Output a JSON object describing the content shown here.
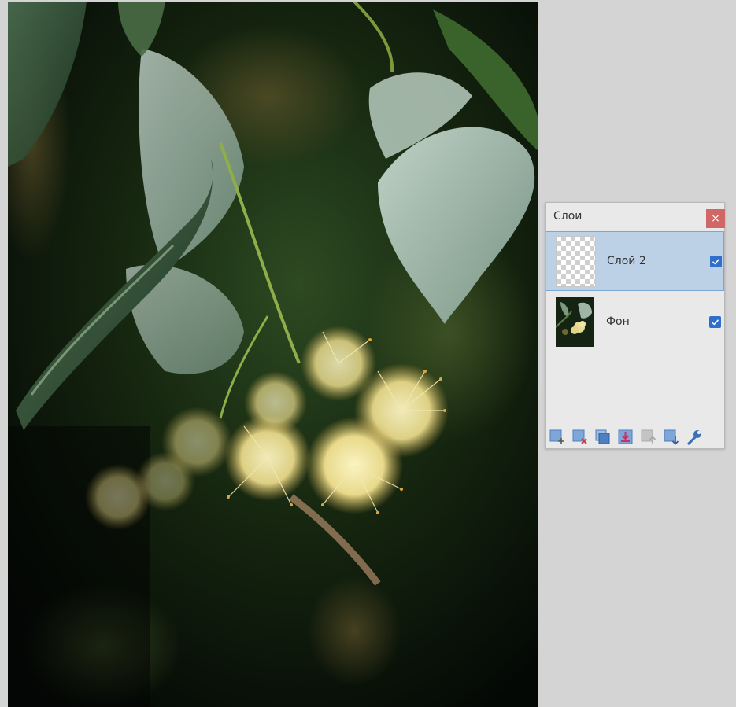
{
  "layers_panel": {
    "title": "Слои",
    "close_label": "×",
    "layers": [
      {
        "name": "Слой 2",
        "visible": true,
        "selected": true,
        "thumbnail": "transparent-checkerboard"
      },
      {
        "name": "Фон",
        "visible": true,
        "selected": false,
        "thumbnail": "linden-blossom-photo"
      }
    ],
    "toolbar": [
      {
        "icon": "add-layer-icon",
        "enabled": true
      },
      {
        "icon": "delete-layer-icon",
        "enabled": true
      },
      {
        "icon": "duplicate-layer-icon",
        "enabled": true
      },
      {
        "icon": "merge-layer-down-icon",
        "enabled": true
      },
      {
        "icon": "move-layer-up-icon",
        "enabled": false
      },
      {
        "icon": "move-layer-down-icon",
        "enabled": true
      },
      {
        "icon": "layer-properties-icon",
        "enabled": true
      }
    ]
  },
  "colors": {
    "workspace_bg": "#d4d4d4",
    "selected_row": "#bcd0e6",
    "checkbox": "#2f6fcb",
    "close_button": "#d06666"
  }
}
